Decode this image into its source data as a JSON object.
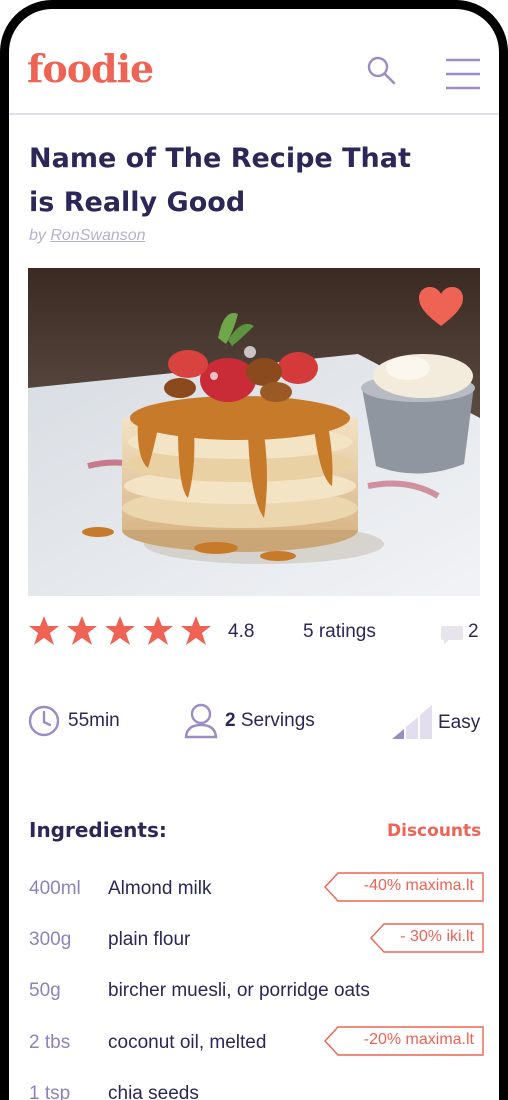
{
  "app": {
    "logo": "foodie"
  },
  "header": {
    "search_icon": "search-icon",
    "menu_icon": "menu-icon"
  },
  "recipe": {
    "title": "Name of The Recipe That is Really Good",
    "by_label": "by",
    "author": "RonSwanson",
    "favorited": true
  },
  "ratings": {
    "stars_filled": 5,
    "stars_total": 5,
    "value": "4.8",
    "count_label": "5 ratings",
    "comments": "2"
  },
  "meta": {
    "time": "55min",
    "servings_number": "2",
    "servings_label": "Servings",
    "difficulty": "Easy"
  },
  "ingredients": {
    "heading": "Ingredients:",
    "discounts_heading": "Discounts",
    "items": [
      {
        "qty": "400ml",
        "name": "Almond milk",
        "discount": "-40% maxima.lt"
      },
      {
        "qty": "300g",
        "name": "plain flour",
        "discount": "- 30% iki.lt"
      },
      {
        "qty": "50g",
        "name": "bircher muesli, or porridge oats",
        "discount": ""
      },
      {
        "qty": "2 tbs",
        "name": "coconut oil, melted",
        "discount": "-20% maxima.lt"
      },
      {
        "qty": "1 tsp",
        "name": "chia seeds",
        "discount": ""
      }
    ]
  },
  "colors": {
    "accent": "#ee6354",
    "primary_text": "#2c2757",
    "muted_purple": "#8e83b8",
    "icon_purple": "#9c8cc4"
  }
}
